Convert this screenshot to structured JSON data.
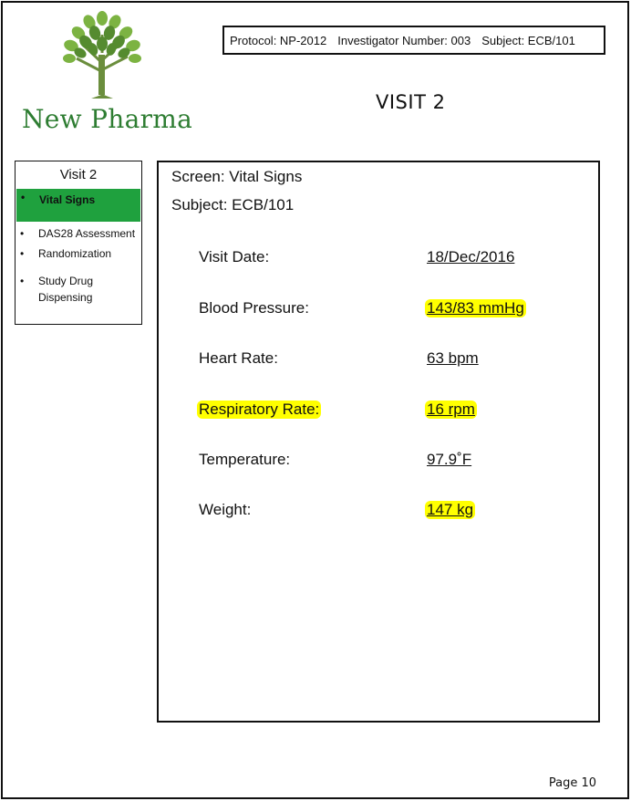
{
  "brand": {
    "name": "New Pharma",
    "color": "#2e7d32",
    "logo_icon": "tree-icon"
  },
  "header": {
    "protocol": "Protocol: NP-2012",
    "investigator": "Investigator Number: 003",
    "subject": "Subject: ECB/101",
    "visit_title": "VISIT 2"
  },
  "sidebar": {
    "title": "Visit 2",
    "items": [
      {
        "label": "Vital Signs",
        "active": true
      },
      {
        "label": "DAS28 Assessment",
        "active": false
      },
      {
        "label": "Randomization",
        "active": false
      },
      {
        "label": "Study Drug Dispensing",
        "active": false
      }
    ],
    "active_color": "#1fa13e"
  },
  "screen": {
    "screen_label": "Screen: Vital Signs",
    "subject_label": "Subject: ECB/101",
    "fields": [
      {
        "label": "Visit Date:",
        "value": "18/Dec/2016"
      },
      {
        "label": "Blood Pressure:",
        "value": "143/83 mmHg"
      },
      {
        "label": "Heart Rate:",
        "value": "63 bpm"
      },
      {
        "label": "Respiratory Rate:",
        "value": "16 rpm"
      },
      {
        "label": "Temperature:",
        "value": "97.9˚F"
      },
      {
        "label": "Weight:",
        "value": "147 kg"
      }
    ],
    "highlight_color": "#ffff00"
  },
  "footer": {
    "page": "Page 10"
  }
}
